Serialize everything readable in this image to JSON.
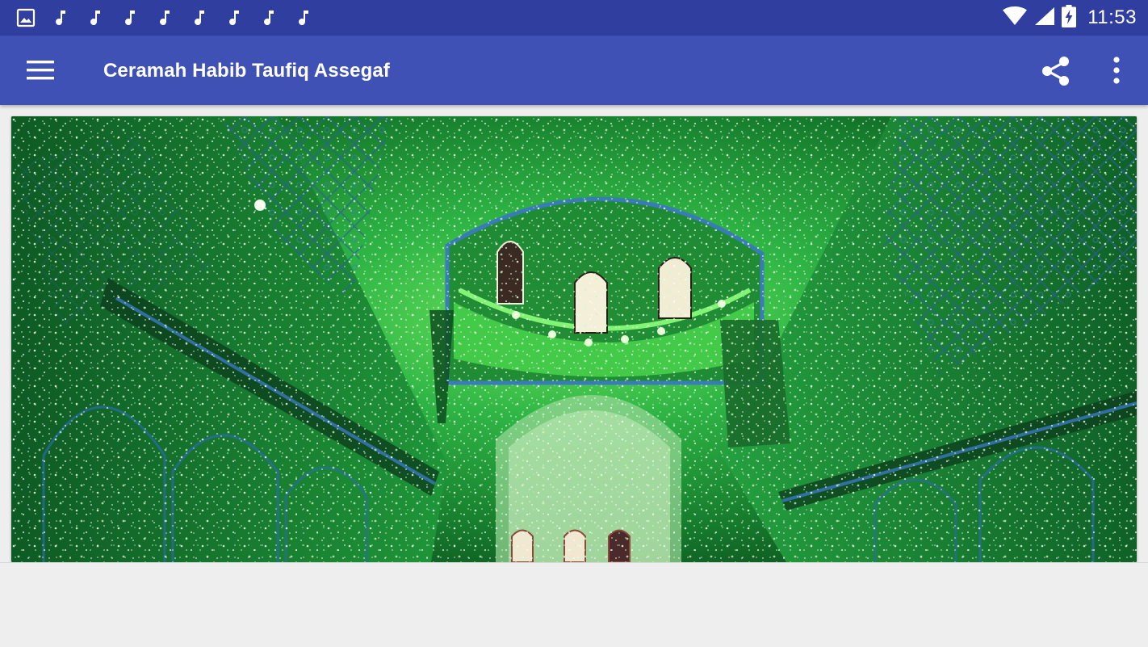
{
  "status_bar": {
    "time": "11:53",
    "notification_icons": [
      "image-icon",
      "music-note-icon",
      "music-note-icon",
      "music-note-icon",
      "music-note-icon",
      "music-note-icon",
      "music-note-icon",
      "music-note-icon",
      "music-note-icon"
    ],
    "system_icons": [
      "wifi-icon",
      "signal-icon",
      "battery-charging-icon"
    ]
  },
  "app_bar": {
    "title": "Ceramah Habib Taufiq Assegaf",
    "background_color": "#3f51b5",
    "status_color": "#303f9f",
    "menu_icon": "hamburger-menu-icon",
    "share_icon": "share-icon",
    "overflow_icon": "more-vert-icon"
  },
  "banner": {
    "icon": "mosque-interior-image",
    "dominant_color": "#1f9a3c"
  },
  "background_color": "#eeeeee"
}
